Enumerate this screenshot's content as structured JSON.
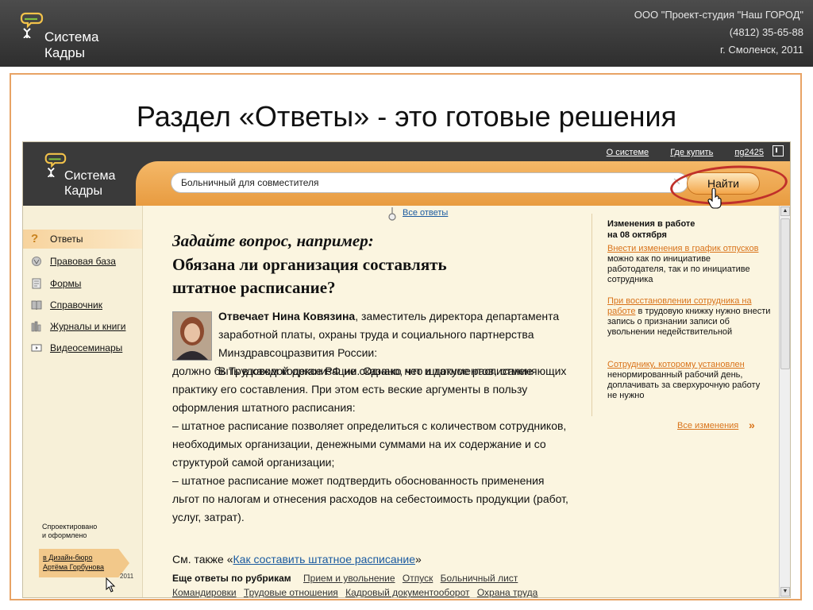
{
  "topbar": {
    "logo_line1": "Система",
    "logo_line2": "Кадры",
    "company": "ООО \"Проект-студия \"Наш ГОРОД\"",
    "phone": "(4812) 35-65-88",
    "city": "г. Смоленск, 2011"
  },
  "slide": {
    "title": "Раздел «Ответы» - это готовые решения"
  },
  "app": {
    "logo_line1": "Система",
    "logo_line2": "Кадры",
    "links": {
      "about": "О системе",
      "buy": "Где купить",
      "user": "пg2425"
    },
    "search": {
      "value": "Больничный для совместителя",
      "button": "Найти"
    },
    "sidebar": {
      "items": [
        {
          "label": "Ответы",
          "icon": "question-icon"
        },
        {
          "label": "Правовая база",
          "icon": "emblem-icon"
        },
        {
          "label": "Формы",
          "icon": "form-icon"
        },
        {
          "label": "Справочник",
          "icon": "book-icon"
        },
        {
          "label": "Журналы и книги",
          "icon": "books-icon"
        },
        {
          "label": "Видеосеминары",
          "icon": "video-icon"
        }
      ],
      "designed_line1": "Спроектировано",
      "designed_line2": "и оформлено",
      "studio_line1": "в Дизайн-бюро",
      "studio_line2": "Артёма Горбунова",
      "year": "2011"
    },
    "main": {
      "all_answers": "Все ответы",
      "question_prompt": "Задайте вопрос, например:",
      "question_line1": "Обязана ли организация составлять",
      "question_line2": "штатное расписание?",
      "answerer_name": "Отвечает Нина Ковязина",
      "answerer_desc": ", заместитель директора департамента заработной платы, охраны труда и социального партнерства Минздравсоцразвития России:",
      "answer_intro": "В Трудовом кодексе РФ не сказано, что штатное расписание",
      "answer_rest": "должно быть в каждой организации. Однако нет и документов, отменяющих практику его составления. При этом есть веские аргументы в пользу оформления штатного расписания:",
      "bullet1": "– штатное расписание позволяет определиться с количеством сотрудников, необходимых организации, денежными суммами на их содержание и со структурой самой организации;",
      "bullet2": "– штатное расписание может подтвердить обоснованность применения льгот по налогам и отнесения расходов на себестоимость продукции (работ, услуг, затрат).",
      "see_also_prefix": "См. также «",
      "see_also_link": "Как составить штатное расписание",
      "see_also_suffix": "»",
      "more_label": "Еще ответы по рубрикам",
      "rubrics": [
        "Прием и увольнение",
        "Отпуск",
        "Больничный лист",
        "Командировки",
        "Трудовые отношения",
        "Кадровый документооборот",
        "Охрана труда"
      ]
    },
    "changes": {
      "title_line1": "Изменения в работе",
      "title_line2": "на 08 октября",
      "item1_link": "Внести изменения в график отпусков",
      "item1_text": " можно как по инициативе работодателя, так и по инициативе сотрудника",
      "item2_link": "При восстановлении сотрудника на работе",
      "item2_text": " в трудовую книжку нужно внести запись о признании записи об увольнении недействительной",
      "item3_link": "Сотруднику, которому установлен",
      "item3_text": " ненормированный рабочий день, доплачивать за сверхурочную работу не нужно",
      "all_changes": "Все изменения",
      "arrows": "»"
    }
  }
}
